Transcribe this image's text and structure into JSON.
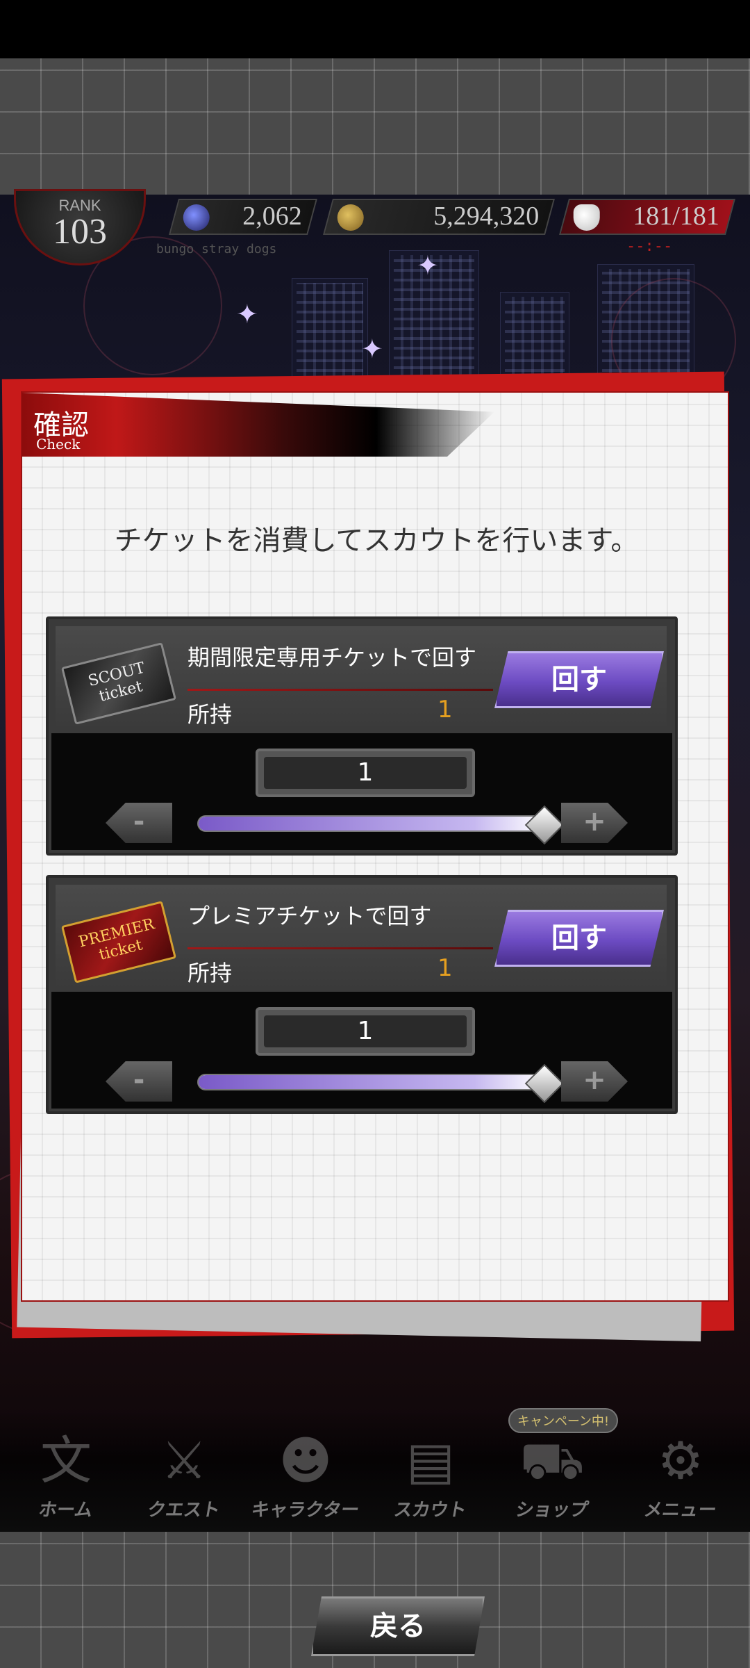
{
  "status_bar": {
    "rank_label": "RANK",
    "rank_value": "103",
    "gems": "2,062",
    "coins": "5,294,320",
    "stamina": "181/181",
    "subtitle": "bungo stray dogs",
    "timer": "--:--"
  },
  "dialog": {
    "title": "確認",
    "subtitle": "Check",
    "message": "チケットを消費してスカウトを行います。",
    "panels": [
      {
        "ticket_label": "SCOUT ticket",
        "ticket_name": "期間限定専用チケットで回す",
        "owned_label": "所持",
        "owned_count": "1",
        "spin_label": "回す",
        "quantity": "1",
        "slider_level": 1.0,
        "minus": "-",
        "plus": "+"
      },
      {
        "ticket_label": "PREMIER ticket",
        "ticket_name": "プレミアチケットで回す",
        "owned_label": "所持",
        "owned_count": "1",
        "spin_label": "回す",
        "quantity": "1",
        "slider_level": 1.0,
        "minus": "-",
        "plus": "+"
      }
    ],
    "back_label": "戻る"
  },
  "campaign_badge": "キャンペーン中!",
  "nav": {
    "items": [
      {
        "label": "ホーム",
        "icon": "home-icon"
      },
      {
        "label": "クエスト",
        "icon": "quest-icon"
      },
      {
        "label": "キャラクター",
        "icon": "character-icon"
      },
      {
        "label": "スカウト",
        "icon": "scout-icon"
      },
      {
        "label": "ショップ",
        "icon": "shop-icon"
      },
      {
        "label": "メニュー",
        "icon": "menu-icon"
      }
    ]
  },
  "colors": {
    "accent_red": "#c01818",
    "spin_purple": "#6c4bc2",
    "count_orange": "#e6a020"
  }
}
